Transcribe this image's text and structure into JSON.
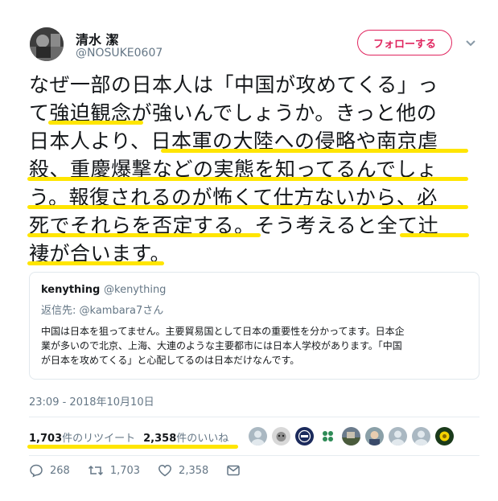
{
  "author": {
    "name": "清水 潔",
    "handle": "@NOSUKE0607"
  },
  "follow_button": "フォローする",
  "tweet_lines": [
    "なぜ一部の日本人は「中国が攻めてくる」っ",
    "て強迫観念が強いんでしょうか。きっと他の",
    "日本人より、日本軍の大陸への侵略や南京虐",
    "殺、重慶爆撃などの実態を知ってるんでしょ",
    "う。報復されるのが怖くて仕方ないから、必",
    "死でそれらを否定する。そう考えると全て辻",
    "褄が合います。"
  ],
  "quoted": {
    "name": "kenything",
    "handle": "@kenything",
    "reply_prefix": "返信先:",
    "reply_to": "@kambara7さん",
    "text_lines": [
      "中国は日本を狙ってません。主要貿易国として日本の重要性を分かってます。日本企",
      "業が多いので北京、上海、大連のような主要都市には日本人学校があります。「中国",
      "が日本を攻めてくる」と心配してるのは日本だけなんです。"
    ]
  },
  "timestamp": "23:09 - 2018年10月10日",
  "stats": {
    "retweets_count": "1,703",
    "retweets_label": "件のリツイート",
    "likes_count": "2,358",
    "likes_label": "件のいいね"
  },
  "likers": [
    {
      "icon": "default-avatar",
      "color": "#aab8c2"
    },
    {
      "icon": "cat-avatar",
      "color": "#c9c9c9"
    },
    {
      "icon": "badge-avatar",
      "color": "#1b2a5c"
    },
    {
      "icon": "clover-avatar",
      "color": "#ffffff"
    },
    {
      "icon": "photo-avatar",
      "color": "#6b7b8c"
    },
    {
      "icon": "face-avatar",
      "color": "#8aa0a8"
    },
    {
      "icon": "default-avatar",
      "color": "#aab8c2"
    },
    {
      "icon": "default-avatar",
      "color": "#aab8c2"
    },
    {
      "icon": "flower-avatar",
      "color": "#1a3a1a"
    }
  ],
  "actions": {
    "reply_count": "268",
    "retweet_count": "1,703",
    "like_count": "2,358"
  },
  "colors": {
    "highlight": "#ffe500",
    "follow": "#e0245e",
    "muted": "#657786"
  }
}
